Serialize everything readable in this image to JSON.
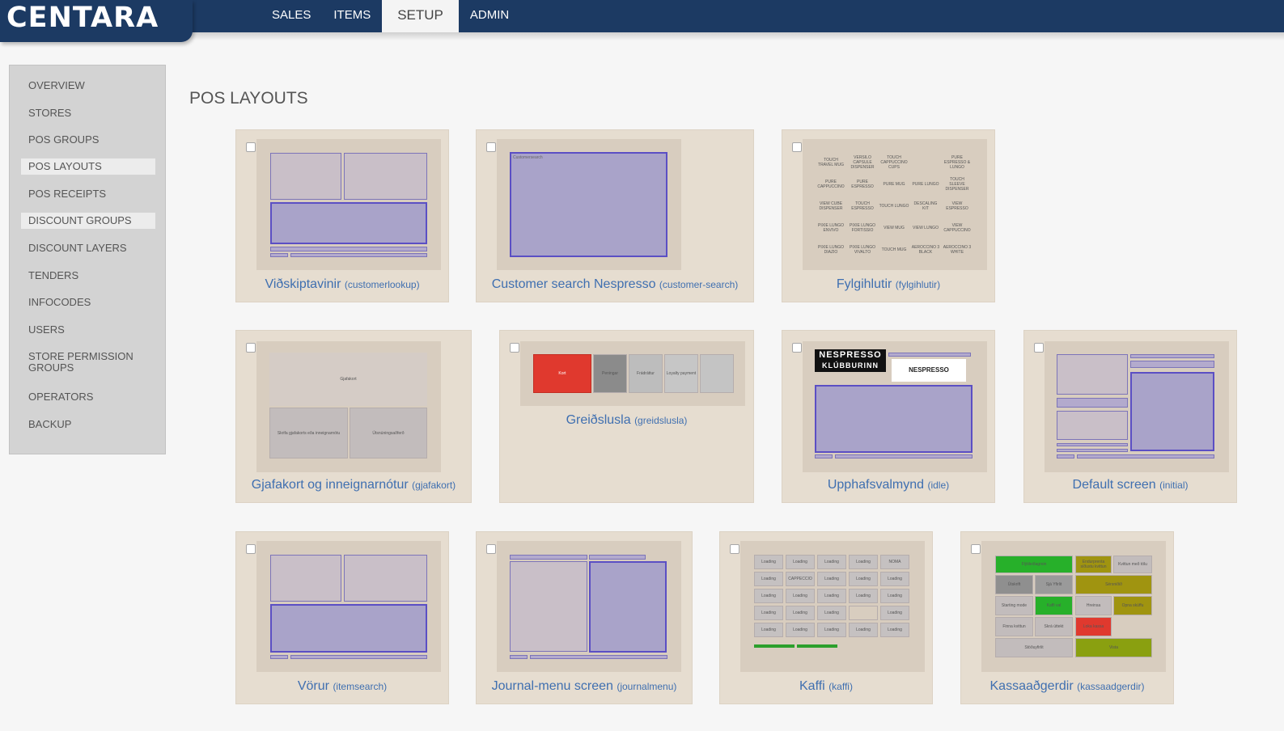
{
  "app": {
    "logo": "CENTARA"
  },
  "nav": {
    "tabs": [
      {
        "label": "SALES"
      },
      {
        "label": "ITEMS"
      },
      {
        "label": "SETUP"
      },
      {
        "label": "ADMIN"
      }
    ],
    "active": "SETUP"
  },
  "sidebar": {
    "items": [
      {
        "label": "OVERVIEW"
      },
      {
        "label": "STORES"
      },
      {
        "label": "POS GROUPS"
      },
      {
        "label": "POS LAYOUTS"
      },
      {
        "label": "POS RECEIPTS"
      },
      {
        "label": "DISCOUNT GROUPS"
      },
      {
        "label": "DISCOUNT LAYERS"
      },
      {
        "label": "TENDERS"
      },
      {
        "label": "INFOCODES"
      },
      {
        "label": "USERS"
      },
      {
        "label": "STORE PERMISSION GROUPS"
      },
      {
        "label": "OPERATORS"
      },
      {
        "label": "BACKUP"
      }
    ],
    "active": "POS LAYOUTS"
  },
  "page": {
    "title": "POS LAYOUTS"
  },
  "layouts": [
    {
      "name": "Viðskiptavinir",
      "code": "(customerlookup)"
    },
    {
      "name": "Customer search Nespresso",
      "code": "(customer-search)"
    },
    {
      "name": "Fylgihlutir",
      "code": "(fylgihlutir)"
    },
    {
      "name": "Gjafakort og inneignarnótur",
      "code": "(gjafakort)"
    },
    {
      "name": "Greiðslusla",
      "code": "(greidslusla)"
    },
    {
      "name": "Upphafsvalmynd",
      "code": "(idle)"
    },
    {
      "name": "Default screen",
      "code": "(initial)"
    },
    {
      "name": "Vörur",
      "code": "(itemsearch)"
    },
    {
      "name": "Journal-menu screen",
      "code": "(journalmenu)"
    },
    {
      "name": "Kaffi",
      "code": "(kaffi)"
    },
    {
      "name": "Kassaaðgerdir",
      "code": "(kassaadgerdir)"
    }
  ],
  "thumbs": {
    "customer_search_label": "Customersearch",
    "fylgihlutir_tiles": [
      "TOUCH TRAVEL MUG",
      "VERSILO CAPSULE DISPENSER",
      "TOUCH CAPPUCCINO CUPS",
      "",
      "PURE ESPRESSO & LUNGO",
      "PURE CAPPUCCINO",
      "PURE ESPRESSO",
      "PURE MUG",
      "PURE LUNGO",
      "TOUCH SLEEVE DISPENSER",
      "VIEW CUBE DISPENSER",
      "TOUCH ESPRESSO",
      "TOUCH LUNGO",
      "DESCALING KIT",
      "VIEW ESPRESSO",
      "PIXIE LUNGO ENVIVO",
      "PIXIE LUNGO FORTISSIO",
      "VIEW MUG",
      "VIEW LUNGO",
      "VIEW CAPPUCCINO",
      "PIXIE LUNGO DIAZIO",
      "PIXIE LUNGO VIVALTO",
      "TOUCH MUG",
      "AEROCCINO 3 BLACK",
      "AEROCCINO 3 WHITE"
    ],
    "gjafakort": {
      "top": "Gjafakort",
      "left": "Skrifa gjafakorts eða inneignarnótu",
      "right": "Útsnúningsaðferð"
    },
    "greidslusla_tiles": [
      "Kort",
      "Peningar",
      "Frádráttur",
      "Loyalty payment",
      ""
    ],
    "nespresso": {
      "brand": "NESPRESSO",
      "sub": "KLÚBBURINN",
      "logo": "NESPRESSO"
    },
    "kaffi_tiles": [
      "Loading",
      "Loading",
      "Loading",
      "Loading",
      "NOMA",
      "Loading",
      "CAPPECCIO",
      "Loading",
      "Loading",
      "Loading",
      "Loading",
      "Loading",
      "Loading",
      "Loading",
      "Loading",
      "Loading",
      "Loading",
      "Loading",
      "",
      "Loading",
      "Loading",
      "Loading",
      "Loading",
      "Loading",
      "Loading"
    ],
    "kassa_tiles": [
      "Flýtileiðagrein",
      "Endurprenta síðustu kvittun",
      "Kvittun með tölu",
      "Útskrift",
      "Sjá Yfirlit",
      "Sérsniðið",
      "Starting mode",
      "Kaffi val",
      "Hreinsa",
      "Opna skúffu",
      "Finna kvittun",
      "Skrá úttekt",
      "Loka kassa",
      "Stöðuyfirlit",
      "Vista"
    ]
  }
}
